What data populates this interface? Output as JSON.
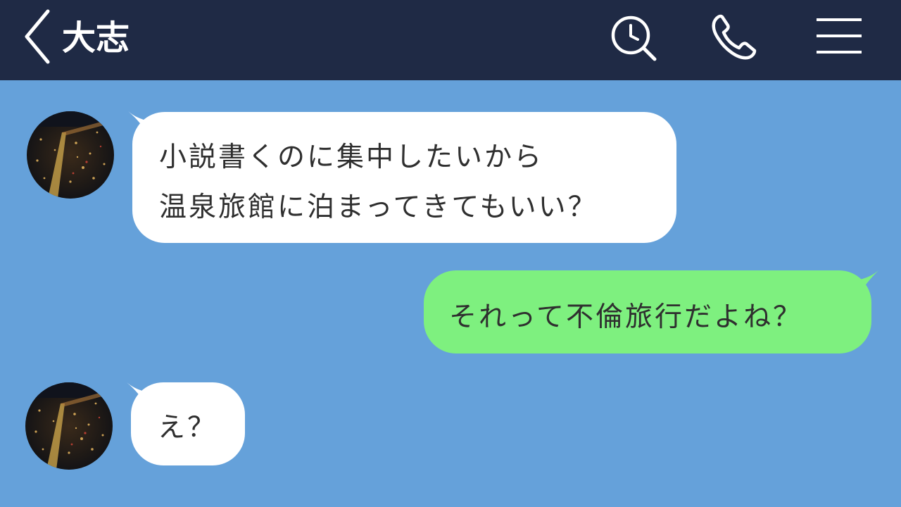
{
  "header": {
    "title": "大志"
  },
  "messages": [
    {
      "side": "incoming",
      "lines": [
        "小説書くのに集中したいから",
        "温泉旅館に泊まってきてもいい？"
      ]
    },
    {
      "side": "outgoing",
      "lines": [
        "それって不倫旅行だよね？"
      ]
    },
    {
      "side": "incoming",
      "lines": [
        "え？"
      ]
    }
  ],
  "colors": {
    "header_bg": "#1f2a45",
    "chat_bg": "#65a1da",
    "incoming_bubble": "#ffffff",
    "outgoing_bubble": "#7ef07f",
    "text": "#2f2f2f"
  },
  "icons": [
    "back-chevron-icon",
    "search-clock-icon",
    "phone-icon",
    "hamburger-menu-icon"
  ]
}
